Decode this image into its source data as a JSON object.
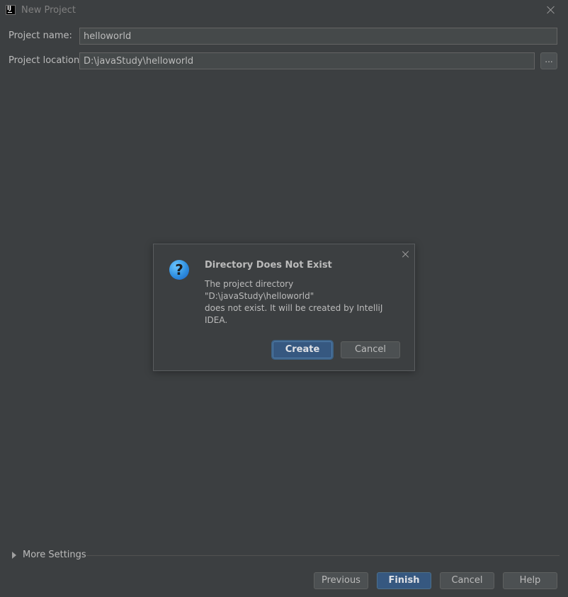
{
  "window": {
    "title": "New Project",
    "app_icon_text": "IJ"
  },
  "form": {
    "project_name_label": "Project name:",
    "project_name_value": "helloworld",
    "project_location_label": "Project location:",
    "project_location_value": "D:\\javaStudy\\helloworld",
    "browse_label": "..."
  },
  "dialog": {
    "title": "Directory Does Not Exist",
    "icon": "question-icon",
    "icon_glyph": "?",
    "message_lines": [
      "The project directory",
      "\"D:\\javaStudy\\helloworld\"",
      "does not exist. It will be created by IntelliJ",
      "IDEA."
    ],
    "create_label": "Create",
    "cancel_label": "Cancel"
  },
  "more_settings": {
    "label": "More Settings",
    "expanded": false
  },
  "footer": {
    "previous_label": "Previous",
    "finish_label": "Finish",
    "cancel_label": "Cancel",
    "help_label": "Help"
  },
  "colors": {
    "background": "#3c3f41",
    "primary_button": "#365880",
    "question_icon": "#2f8fe0"
  }
}
